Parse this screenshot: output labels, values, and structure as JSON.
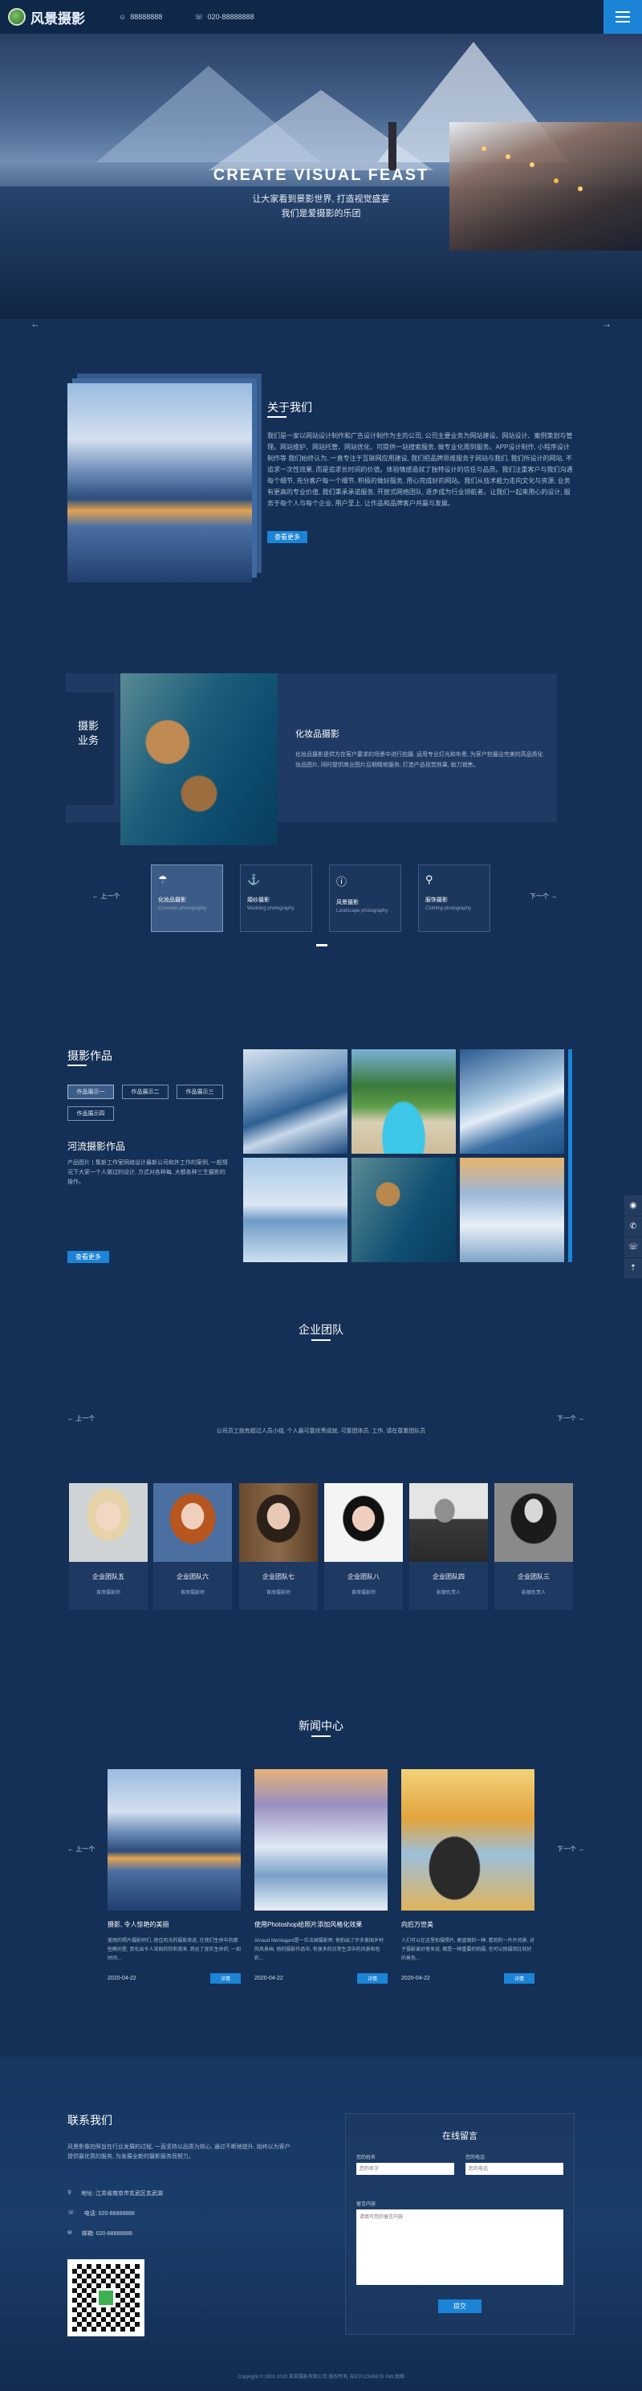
{
  "header": {
    "logo_text": "风景摄影",
    "info_1": "88888888",
    "info_2": "020-88888888",
    "menu_icon": "hamburger-icon"
  },
  "hero": {
    "title": "CREATE VISUAL FEAST",
    "subtitle_1": "让大家看到景影世界, 打造视觉盛宴",
    "subtitle_2": "我们是爱摄影的乐团"
  },
  "about": {
    "title": "关于我们",
    "text": "我们是一家以网站设计制作和广告设计制作为主的公司, 公司主要业务为网站建设、网站设计、案例策划与管理。网站维护、网站托管、网站优化、可提供一站搜索服务, 做专业化周到服务。APP设计制作, 小程序设计制作等 我们始终认为, 一直专注于互联网应用建设, 我们把品牌思维服务于网站与我们, 我们所设计的网站, 不追求一次性效果, 而是追求长时间的价值。体验情感造就了独特设计的信任与品质。我们注重客户与我们沟通每个细节, 充分客户每一个细节, 积极的做好服务, 用心完成好的网站。我们从技术能力走向文化与资源, 业务有更高的专业价值, 我们秉承承诺服务, 开放式网络团队, 逐步成为行业领航者。让我们一起来用心的设计, 服务于每个人与每个企业, 用户至上, 让作品和品牌客户共赢与发展。",
    "button": "查看更多"
  },
  "service": {
    "vertical_title": "摄影业务",
    "item_title": "化妆品摄影",
    "item_text": "化妆品摄影是供方在客户要求的场景中进行拍摄, 运用专业灯光和布景, 为客户拍摄出完美的高品质化妆品图片, 同时提供商业图片后期精修服务, 打造产品视觉效果, 助力销售。",
    "prev": "上一个",
    "next": "下一个",
    "cards": [
      {
        "icon": "umbrella-icon",
        "title": "化妆品摄影",
        "sub": "Cosmetic photography"
      },
      {
        "icon": "anchor-icon",
        "title": "婚纱摄影",
        "sub": "Wedding photography"
      },
      {
        "icon": "alert-icon",
        "title": "风景摄影",
        "sub": "Landscape photography"
      },
      {
        "icon": "pin-icon",
        "title": "服饰摄影",
        "sub": "Clothing photography"
      }
    ]
  },
  "works": {
    "title": "摄影作品",
    "tabs": [
      "作品展示一",
      "作品展示二",
      "作品展示三",
      "作品展示四"
    ],
    "sub_title": "河流摄影作品",
    "text": "产品图片丨集新工作室网络设计最新公司和外工作的案例, 一般情况下大家一个人做过的设计, 方式对各种每, 大都各种三生摄影的操作。",
    "button": "查看更多"
  },
  "team": {
    "title": "企业团队",
    "intro": "公司员工就有超过人员小组, 个人最可靠优秀成就, 可靠团体员, 工作, 请在尊重团队员",
    "prev": "上一个",
    "next": "下一个",
    "members": [
      {
        "name": "企业团队五",
        "role": "首席摄影师"
      },
      {
        "name": "企业团队六",
        "role": "首席摄影师"
      },
      {
        "name": "企业团队七",
        "role": "首席摄影师"
      },
      {
        "name": "企业团队八",
        "role": "首席摄影师"
      },
      {
        "name": "企业团队四",
        "role": "影棚负责人"
      },
      {
        "name": "企业团队三",
        "role": "影棚负责人"
      }
    ]
  },
  "news": {
    "title": "新闻中心",
    "prev": "上一个",
    "next": "下一个",
    "items": [
      {
        "title": "摄影, 令人惊艳的美丽",
        "text": "美丽的照片摄影师们, 绝佳风光的摄影奇迹, 在我们生命中的那些瞬间里, 变化出令人深刻的你和我来, 到达了现实生命的, 一如时间...",
        "date": "2020-04-22",
        "more": "详情"
      },
      {
        "title": "使用Photoshop给照片添加风格化效果",
        "text": "Arnaud Montagard是一位法国摄影师, 他拍出了许多美国乡村的风景画, 他的摄影作品中, 有很多的日常生活中的风景和色彩...",
        "date": "2020-04-22",
        "more": "详情"
      },
      {
        "title": "向后万世美",
        "text": "人们可以在这里拍摄照片, 更直观的一种, 看到的一片片风景, 对于摄影爱好者来说, 都是一种重要的拍摄, 也可以拍摄到比较好的景色...",
        "date": "2020-04-22",
        "more": "详情"
      }
    ]
  },
  "contact": {
    "title": "联系我们",
    "text": "风景影像拍照旨在行业发展的过程, 一直坚持以品质为核心, 通过不断地提升, 始终以为客户提供最优质的服务, 为发展全新的摄影服务而努力。",
    "address": "地址: 江苏省南京市玄武区玄武湖",
    "phone": "电话: 020-88888888",
    "email": "邮箱: 020-88888888",
    "qr_icon": "qr-code-icon"
  },
  "form": {
    "title": "在线留言",
    "name_label": "您的姓名",
    "name_placeholder": "您的名字",
    "phone_label": "您的电话",
    "phone_placeholder": "您的电话",
    "msg_label": "留言内容",
    "msg_placeholder": "请填写您的留言内容",
    "submit": "提交"
  },
  "footer": {
    "copyright": "Copyright © 2002-2020 某某摄影有限公司 版权所有  苏ICP12345678  XML地图"
  },
  "side_icons": [
    "qq-icon",
    "chat-icon",
    "phone-icon",
    "top-icon"
  ],
  "colors": {
    "accent": "#1b84d6",
    "background": "#153056"
  }
}
